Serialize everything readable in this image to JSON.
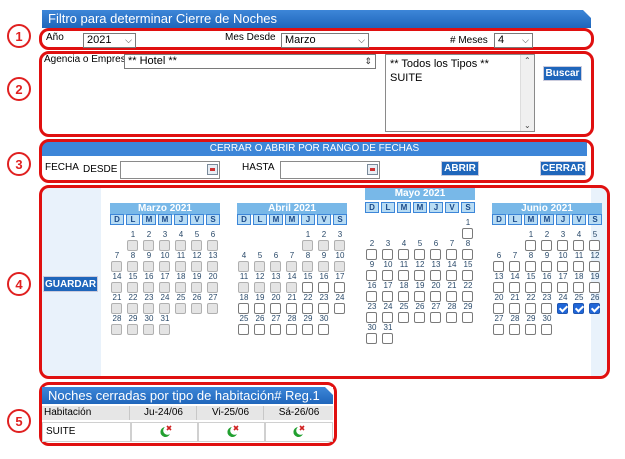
{
  "markers": [
    "1",
    "2",
    "3",
    "4",
    "5"
  ],
  "filter": {
    "title": "Filtro para determinar Cierre de Noches",
    "year_label": "Año",
    "year_value": "2021",
    "mes_desde_label": "Mes Desde",
    "mes_desde_value": "Marzo",
    "meses_label": "# Meses",
    "meses_value": "4",
    "agencia_label": "Agencia o Empresa",
    "agencia_value": "** Hotel **",
    "tipos": [
      "** Todos los Tipos **",
      "SUITE"
    ],
    "buscar_label": "Buscar"
  },
  "range": {
    "title": "CERRAR O ABRIR POR RANGO DE FECHAS",
    "fecha_label": "FECHA",
    "desde_label": "DESDE",
    "hasta_label": "HASTA",
    "desde_value": "",
    "hasta_value": "",
    "abrir_label": "ABRIR",
    "cerrar_label": "CERRAR"
  },
  "calendar": {
    "guardar_label": "GUARDAR",
    "weekdays": [
      "D",
      "L",
      "M",
      "M",
      "J",
      "V",
      "S"
    ],
    "months": [
      {
        "name": "Marzo 2021",
        "start": 1,
        "days": 31,
        "checked": []
      },
      {
        "name": "Abril 2021",
        "start": 4,
        "days": 30,
        "checked": []
      },
      {
        "name": "Mayo 2021",
        "start": 6,
        "days": 31,
        "checked": []
      },
      {
        "name": "Junio 2021",
        "start": 2,
        "days": 30,
        "checked": [
          24,
          25,
          26
        ]
      }
    ]
  },
  "results": {
    "title": "Noches cerradas por tipo de habitación# Reg.1",
    "headers": [
      "Habitación",
      "Ju-24/06",
      "Vi-25/06",
      "Sá-26/06"
    ],
    "rows": [
      {
        "habitacion": "SUITE",
        "status": [
          "closed",
          "closed",
          "closed"
        ]
      }
    ]
  }
}
